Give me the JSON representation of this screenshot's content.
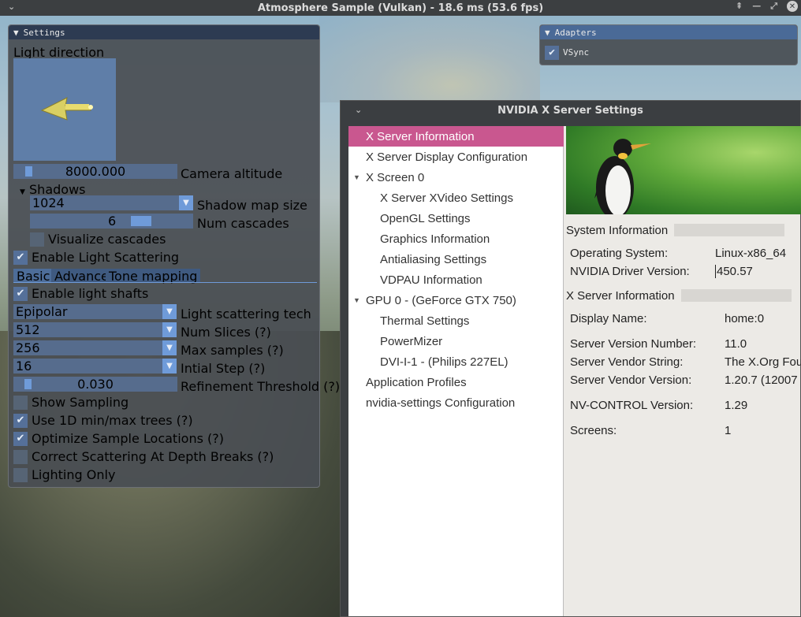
{
  "window": {
    "title": "Atmosphere Sample (Vulkan) - 18.6 ms (53.6 fps)",
    "menu_icon": "chevron-down-icon",
    "controls": [
      "pin-icon",
      "minimize-icon",
      "maximize-icon",
      "close-icon"
    ]
  },
  "settings": {
    "title": "Settings",
    "light_direction_label": "Light direction",
    "camera_altitude": {
      "value": "8000.000",
      "label": "Camera altitude",
      "fraction": 0.07
    },
    "shadows_header": "Shadows",
    "shadow_map_size": {
      "value": "1024",
      "label": "Shadow map size"
    },
    "num_cascades": {
      "value": "6",
      "label": "Num cascades",
      "fraction": 0.62
    },
    "visualize_cascades": {
      "label": "Visualize cascades",
      "checked": false
    },
    "enable_light_scattering": {
      "label": "Enable Light Scattering",
      "checked": true
    },
    "tabs": [
      "Basic",
      "Advanced",
      "Tone mapping"
    ],
    "enable_light_shafts": {
      "label": "Enable light shafts",
      "checked": true
    },
    "light_scattering_tech": {
      "value": "Epipolar",
      "label": "Light scattering tech"
    },
    "num_slices": {
      "value": "512",
      "label": "Num Slices (?)"
    },
    "max_samples": {
      "value": "256",
      "label": "Max samples (?)"
    },
    "initial_step": {
      "value": "16",
      "label": "Intial Step (?)"
    },
    "refinement_threshold": {
      "value": "0.030",
      "label": "Refinement Threshold (?)",
      "fraction": 0.06
    },
    "show_sampling": {
      "label": "Show Sampling",
      "checked": false
    },
    "use_1d_trees": {
      "label": "Use 1D min/max trees (?)",
      "checked": true
    },
    "optimize_sample_locations": {
      "label": "Optimize Sample Locations (?)",
      "checked": true
    },
    "correct_scattering": {
      "label": "Correct Scattering At Depth Breaks (?)",
      "checked": false
    },
    "lighting_only": {
      "label": "Lighting Only",
      "checked": false
    }
  },
  "adapters": {
    "title": "Adapters",
    "vsync": {
      "label": "VSync",
      "checked": true
    }
  },
  "nvidia": {
    "title": "NVIDIA X Server Settings",
    "tree": [
      "X Server Information",
      "X Server Display Configuration",
      "X Screen 0",
      "X Server XVideo Settings",
      "OpenGL Settings",
      "Graphics Information",
      "Antialiasing Settings",
      "VDPAU Information",
      "GPU 0 - (GeForce GTX 750)",
      "Thermal Settings",
      "PowerMizer",
      "DVI-I-1 - (Philips 227EL)",
      "Application Profiles",
      "nvidia-settings Configuration"
    ],
    "system_info_header": "System Information",
    "os_label": "Operating System:",
    "os_value": "Linux-x86_64",
    "driver_label": "NVIDIA Driver Version:",
    "driver_value": "450.57",
    "xserver_info_header": "X Server Information",
    "display_name_label": "Display Name:",
    "display_name_value": "home:0",
    "server_version_label": "Server Version Number:",
    "server_version_value": "11.0",
    "vendor_string_label": "Server Vendor String:",
    "vendor_string_value": "The X.Org Fou",
    "vendor_version_label": "Server Vendor Version:",
    "vendor_version_value": "1.20.7 (12007",
    "nvcontrol_label": "NV-CONTROL Version:",
    "nvcontrol_value": "1.29",
    "screens_label": "Screens:",
    "screens_value": "1"
  }
}
